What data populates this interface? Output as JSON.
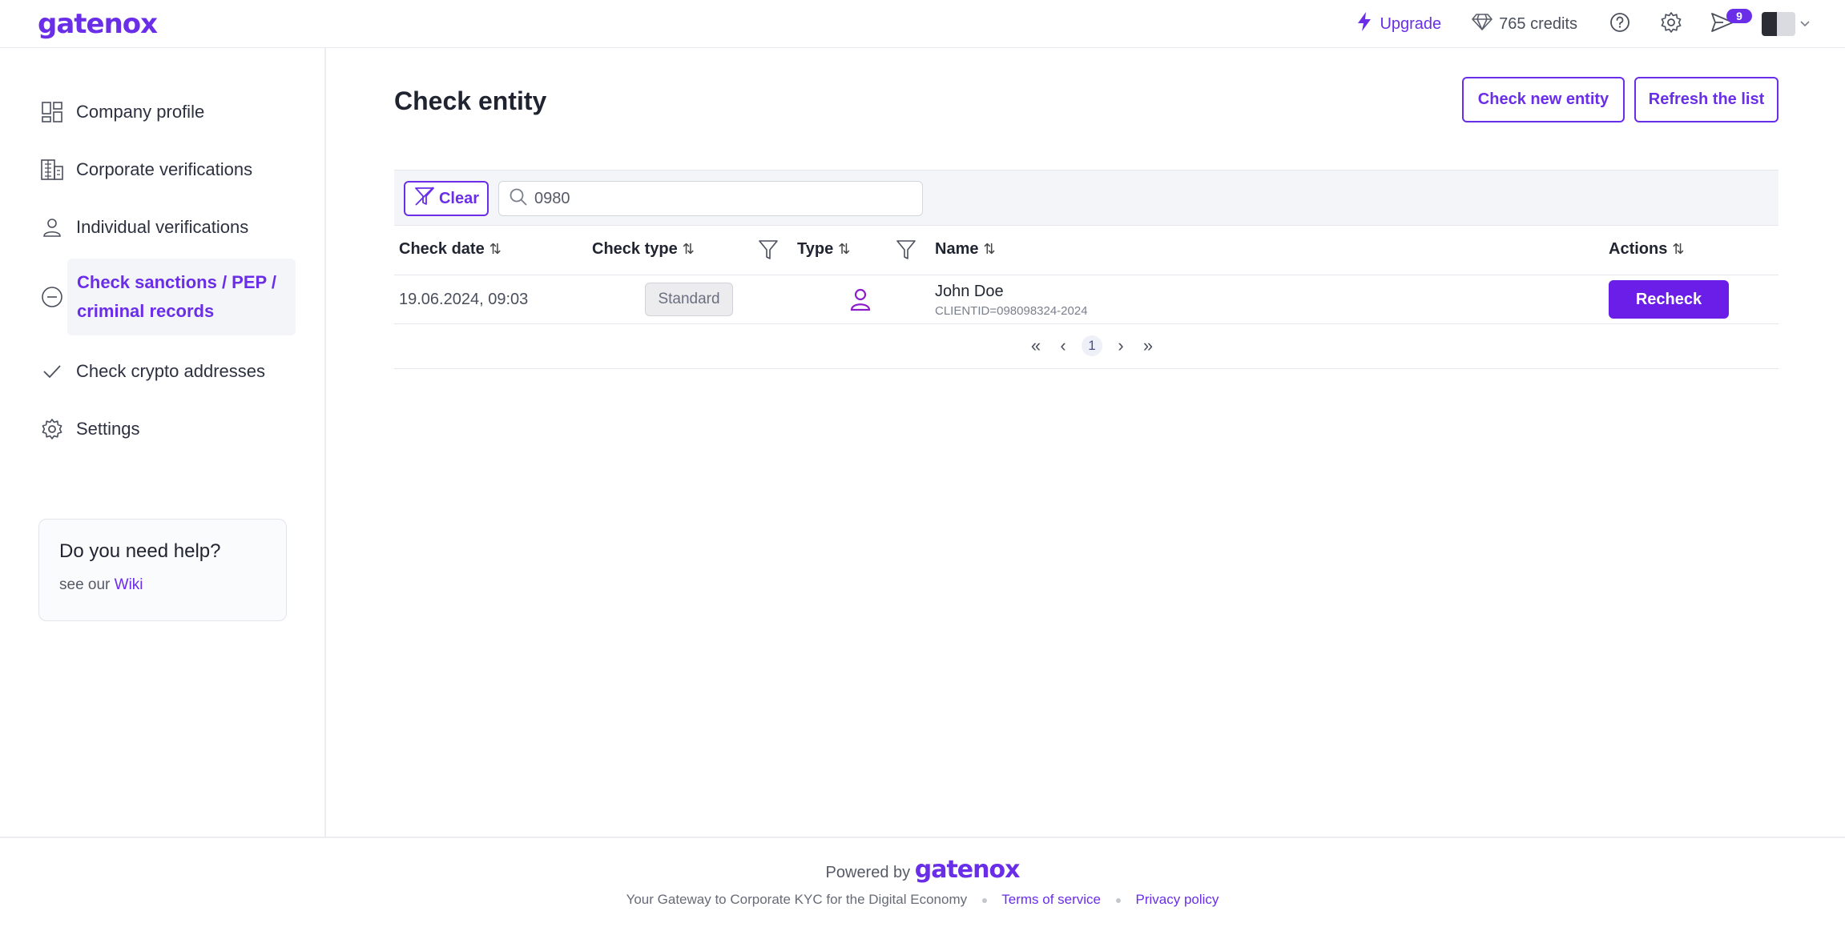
{
  "app": {
    "logo": "gatenox"
  },
  "topbar": {
    "upgrade_label": "Upgrade",
    "credits_label": "765 credits",
    "notification_count": "9"
  },
  "sidebar": {
    "items": [
      {
        "label": "Company profile",
        "icon": "grid-icon"
      },
      {
        "label": "Corporate verifications",
        "icon": "building-icon"
      },
      {
        "label": "Individual verifications",
        "icon": "user-icon"
      },
      {
        "label": "Check sanctions / PEP / criminal records",
        "icon": "minus-circle-icon",
        "active": true
      },
      {
        "label": "Check crypto addresses",
        "icon": "check-icon"
      },
      {
        "label": "Settings",
        "icon": "gear-icon"
      }
    ],
    "help": {
      "title": "Do you need help?",
      "text": "see our",
      "link": "Wiki"
    }
  },
  "main": {
    "title": "Check entity",
    "check_new_label": "Check new entity",
    "refresh_label": "Refresh the list",
    "filter": {
      "clear_label": "Clear",
      "search_value": "0980"
    },
    "columns": [
      "Check date",
      "Check type",
      "Type",
      "Name",
      "Actions"
    ],
    "rows": [
      {
        "check_date": "19.06.2024, 09:03",
        "check_type": "Standard",
        "type_icon": "person-icon",
        "name": "John Doe",
        "client_id": "CLIENTID=098098324-2024",
        "action": "Recheck"
      }
    ],
    "pagination": {
      "current_page": "1"
    }
  },
  "footer": {
    "powered_by": "Powered by",
    "logo": "gatenox",
    "tagline": "Your Gateway to Corporate KYC for the Digital Economy",
    "terms": "Terms of service",
    "privacy": "Privacy policy"
  },
  "colors": {
    "accent": "#6a2ee8",
    "button": "#6a1ee8"
  }
}
